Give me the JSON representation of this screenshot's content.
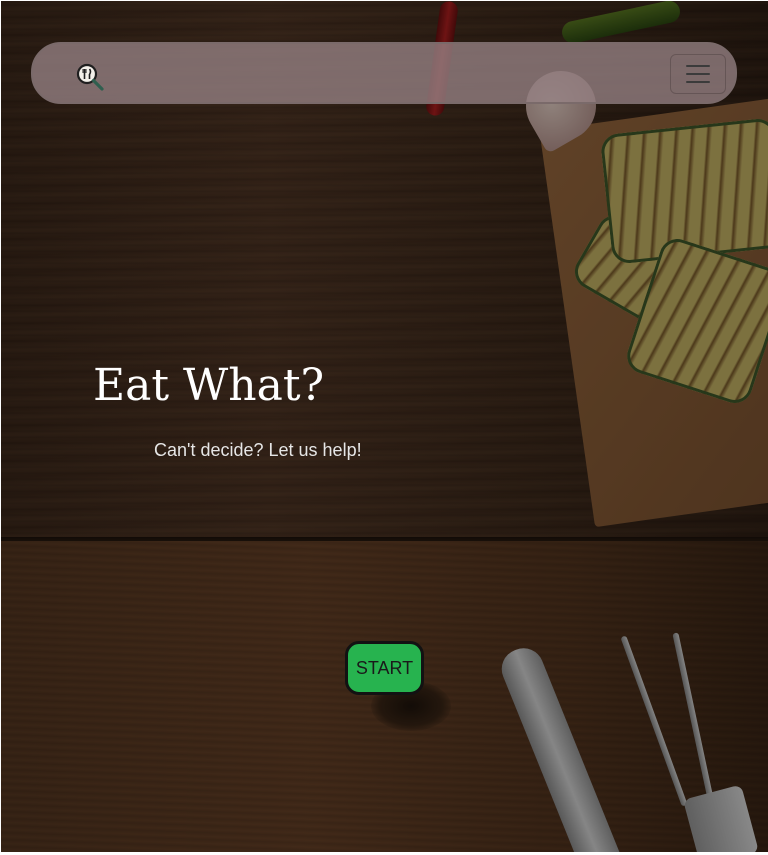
{
  "navbar": {
    "brand_icon": "magnifier-fork-knife-icon",
    "menu_icon": "hamburger-menu-icon",
    "background_color": "#968284"
  },
  "hero": {
    "title": "Eat What?",
    "subtitle": "Can't decide? Let us help!",
    "start_label": "START",
    "start_color": "#27b34f"
  }
}
